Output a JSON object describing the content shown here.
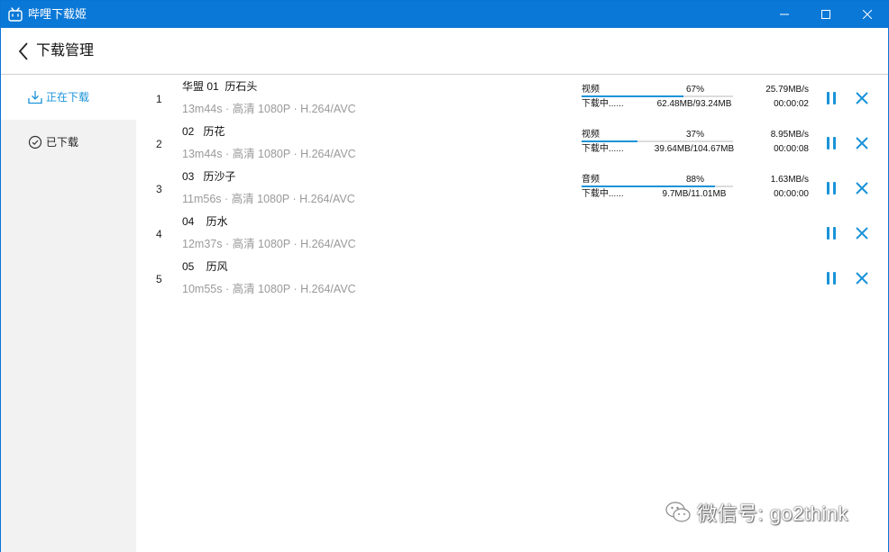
{
  "window": {
    "title": "哔哩下载姬",
    "accent": "#0a78d7",
    "icons": {
      "app": "tv-icon",
      "minimize": "minimize-icon",
      "maximize": "maximize-icon",
      "close": "close-icon"
    }
  },
  "header": {
    "title": "下载管理",
    "back_icon": "chevron-left-icon"
  },
  "sidebar": {
    "items": [
      {
        "label": "正在下载",
        "icon": "download-icon",
        "active": true
      },
      {
        "label": "已下载",
        "icon": "check-circle-icon",
        "active": false
      }
    ]
  },
  "downloads": [
    {
      "index": "1",
      "title": "华盟 01  历石头",
      "meta": "13m44s · 高清 1080P · H.264/AVC",
      "progress": {
        "type": "视频",
        "percent_text": "67%",
        "fraction": 0.67,
        "speed": "25.79MB/s",
        "state": "下载中......",
        "size": "62.48MB/93.24MB",
        "time": "00:00:02"
      }
    },
    {
      "index": "2",
      "title": "02   历花",
      "meta": "13m44s · 高清 1080P · H.264/AVC",
      "progress": {
        "type": "视频",
        "percent_text": "37%",
        "fraction": 0.37,
        "speed": "8.95MB/s",
        "state": "下载中......",
        "size": "39.64MB/104.67MB",
        "time": "00:00:08"
      }
    },
    {
      "index": "3",
      "title": "03   历沙子",
      "meta": "11m56s · 高清 1080P · H.264/AVC",
      "progress": {
        "type": "音频",
        "percent_text": "88%",
        "fraction": 0.88,
        "speed": "1.63MB/s",
        "state": "下载中......",
        "size": "9.7MB/11.01MB",
        "time": "00:00:00"
      }
    },
    {
      "index": "4",
      "title": "04    历水",
      "meta": "12m37s · 高清 1080P · H.264/AVC"
    },
    {
      "index": "5",
      "title": "05    历风",
      "meta": "10m55s · 高清 1080P · H.264/AVC"
    }
  ],
  "row_icons": {
    "pause": "pause-icon",
    "remove": "close-icon"
  },
  "watermark": {
    "text": "微信号: go2think",
    "icon": "wechat-icon"
  }
}
